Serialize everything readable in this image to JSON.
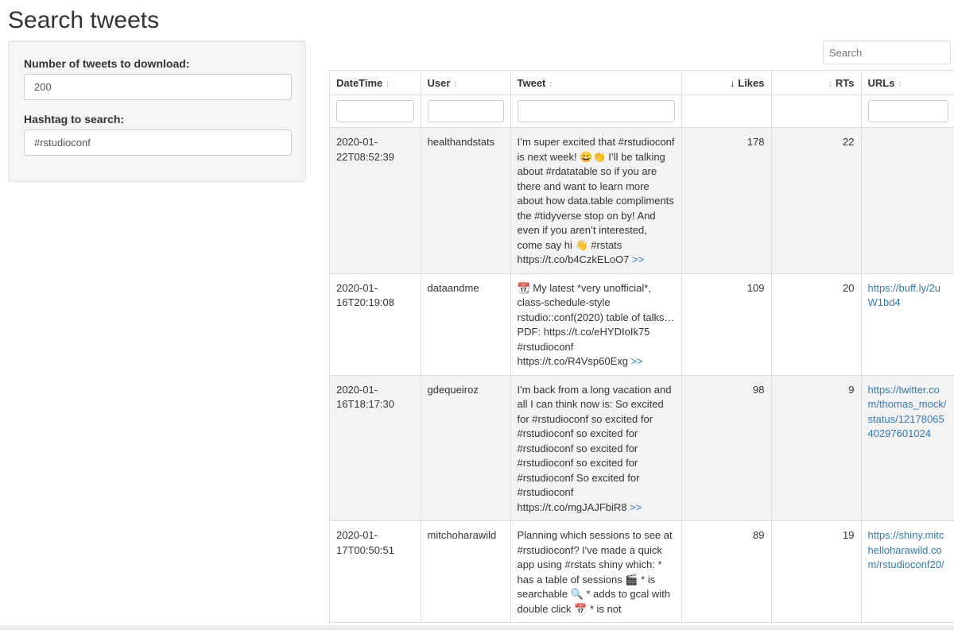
{
  "page": {
    "title": "Search tweets"
  },
  "inputs": {
    "count_label": "Number of tweets to download:",
    "count_value": "200",
    "hashtag_label": "Hashtag to search:",
    "hashtag_value": "#rstudioconf"
  },
  "table": {
    "search_placeholder": "Search",
    "sort_icon": "↕",
    "sorted_icon": "↓",
    "columns": {
      "datetime": "DateTime",
      "user": "User",
      "tweet": "Tweet",
      "likes": "Likes",
      "rts": "RTs",
      "urls": "URLs"
    },
    "more_label": ">>",
    "rows": [
      {
        "datetime": "2020-01-22T08:52:39",
        "user": "healthandstats",
        "tweet": "I’m super excited that #rstudioconf is next week! 😀👏 I’ll be talking about #rdatatable so if you are there and want to learn more about how data.table compliments the #tidyverse stop on by! And even if you aren’t interested, come say hi 👋 #rstats https://t.co/b4CzkELoO7",
        "likes": "178",
        "rts": "22",
        "url": ""
      },
      {
        "datetime": "2020-01-16T20:19:08",
        "user": "dataandme",
        "tweet": "📆 My latest *very unofficial*, class-schedule-style rstudio::conf(2020) table of talks… PDF: https://t.co/eHYDIoIk75 #rstudioconf https://t.co/R4Vsp60Exg",
        "likes": "109",
        "rts": "20",
        "url": "https://buff.ly/2uW1bd4"
      },
      {
        "datetime": "2020-01-16T18:17:30",
        "user": "gdequeiroz",
        "tweet": "I'm back from a long vacation and all I can think now is: So excited for #rstudioconf so excited for #rstudioconf so excited for #rstudioconf so excited for #rstudioconf so excited for #rstudioconf So excited for #rstudioconf https://t.co/mgJAJFbiR8",
        "likes": "98",
        "rts": "9",
        "url": "https://twitter.com/thomas_mock/status/1217806540297601024"
      },
      {
        "datetime": "2020-01-17T00:50:51",
        "user": "mitchoharawild",
        "tweet": "Planning which sessions to see at #rstudioconf? I've made a quick app using #rstats shiny which: * has a table of sessions 🎬 * is searchable 🔍 * adds to gcal with double click 📅 * is not",
        "likes": "89",
        "rts": "19",
        "url": "https://shiny.mitchelloharawild.com/rstudioconf20/"
      }
    ]
  }
}
